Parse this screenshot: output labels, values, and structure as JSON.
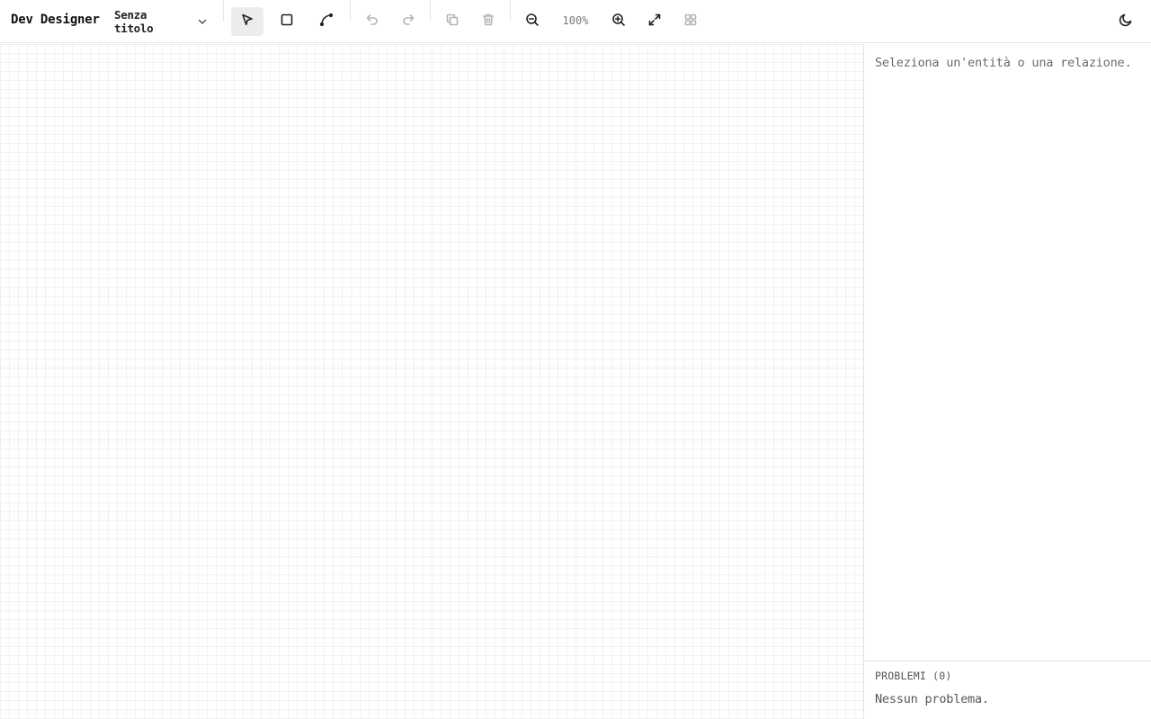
{
  "app": {
    "title": "Dev Designer"
  },
  "document": {
    "name": "Senza titolo"
  },
  "toolbar": {
    "tools": [
      {
        "name": "select-tool",
        "icon": "cursor-arrow-icon",
        "active": true
      },
      {
        "name": "entity-tool",
        "icon": "square-icon",
        "active": false
      },
      {
        "name": "relation-tool",
        "icon": "curve-connector-icon",
        "active": false
      },
      {
        "name": "undo-button",
        "icon": "undo-icon",
        "disabled": true
      },
      {
        "name": "redo-button",
        "icon": "redo-icon",
        "disabled": true
      },
      {
        "name": "duplicate-button",
        "icon": "copy-icon",
        "disabled": true
      },
      {
        "name": "delete-button",
        "icon": "trash-icon",
        "disabled": true
      },
      {
        "name": "zoom-out-button",
        "icon": "zoom-out-icon"
      },
      {
        "name": "zoom-in-button",
        "icon": "zoom-in-icon"
      },
      {
        "name": "fit-view-button",
        "icon": "expand-icon"
      },
      {
        "name": "auto-layout-button",
        "icon": "grid-icon",
        "disabled": true
      },
      {
        "name": "theme-toggle-button",
        "icon": "moon-icon"
      }
    ],
    "zoom_label": "100%"
  },
  "inspector": {
    "empty_message": "Seleziona un'entità o una relazione."
  },
  "problems": {
    "title": "PROBLEMI (0)",
    "empty_message": "Nessun problema."
  },
  "colors": {
    "grid_line": "#f1f1f1",
    "active_tool_bg": "#ececec",
    "disabled_icon": "#b5b5b5"
  }
}
